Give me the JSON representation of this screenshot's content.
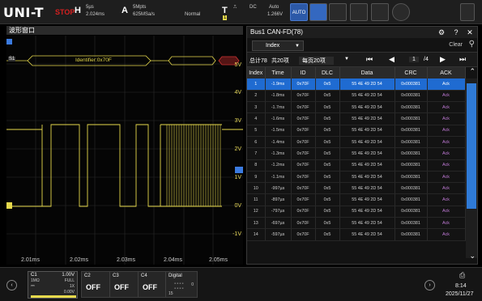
{
  "topbar": {
    "logo": "UNI-T",
    "status": "STOP",
    "horizontal": {
      "letter": "H",
      "timebase": "5µs",
      "offset": "2.024ms"
    },
    "acquire": {
      "letter": "A",
      "depth": "5Mpts",
      "rate": "625MSa/s",
      "mode": "Normal"
    },
    "trigger": {
      "letter": "T",
      "source": "1",
      "coupling": "DC",
      "mode": "Auto",
      "level": "1.266V"
    },
    "auto_label": "AUTO"
  },
  "wave": {
    "title": "波形窗口",
    "decode_label": "Identifier:0x70F",
    "volt_labels": [
      "5V",
      "4V",
      "3V",
      "2V",
      "1V",
      "0V",
      "-1V"
    ],
    "time_labels": [
      "2.01ms",
      "2.02ms",
      "2.03ms",
      "2.04ms",
      "2.05ms"
    ],
    "s1_label": "S1"
  },
  "bus": {
    "title": "Bus1 CAN-FD(78)",
    "select_value": "Index",
    "clear_label": "Clear",
    "total": "总计78",
    "pages_total": "共20项",
    "per_page": "每页20项",
    "page": "1",
    "pages": "/4",
    "columns": [
      "Index",
      "Time",
      "ID",
      "DLC",
      "Data",
      "CRC",
      "ACK"
    ],
    "rows": [
      [
        "1",
        "-1.9ms",
        "0x70F",
        "0x5",
        "55 4E 49 2D 54",
        "0x000381",
        "Ack"
      ],
      [
        "2",
        "-1.8ms",
        "0x70F",
        "0x5",
        "55 4E 49 2D 54",
        "0x000381",
        "Ack"
      ],
      [
        "3",
        "-1.7ms",
        "0x70F",
        "0x5",
        "55 4E 49 2D 54",
        "0x000381",
        "Ack"
      ],
      [
        "4",
        "-1.6ms",
        "0x70F",
        "0x5",
        "55 4E 49 2D 54",
        "0x000381",
        "Ack"
      ],
      [
        "5",
        "-1.5ms",
        "0x70F",
        "0x5",
        "55 4E 49 2D 54",
        "0x000381",
        "Ack"
      ],
      [
        "6",
        "-1.4ms",
        "0x70F",
        "0x5",
        "55 4E 49 2D 54",
        "0x000381",
        "Ack"
      ],
      [
        "7",
        "-1.3ms",
        "0x70F",
        "0x5",
        "55 4E 49 2D 54",
        "0x000381",
        "Ack"
      ],
      [
        "8",
        "-1.2ms",
        "0x70F",
        "0x5",
        "55 4E 49 2D 54",
        "0x000381",
        "Ack"
      ],
      [
        "9",
        "-1.1ms",
        "0x70F",
        "0x5",
        "55 4E 49 2D 54",
        "0x000381",
        "Ack"
      ],
      [
        "10",
        "-997µs",
        "0x70F",
        "0x5",
        "55 4E 49 2D 54",
        "0x000381",
        "Ack"
      ],
      [
        "11",
        "-897µs",
        "0x70F",
        "0x5",
        "55 4E 49 2D 54",
        "0x000381",
        "Ack"
      ],
      [
        "12",
        "-797µs",
        "0x70F",
        "0x5",
        "55 4E 49 2D 54",
        "0x000381",
        "Ack"
      ],
      [
        "13",
        "-697µs",
        "0x70F",
        "0x5",
        "55 4E 49 2D 54",
        "0x000381",
        "Ack"
      ],
      [
        "14",
        "-597µs",
        "0x70F",
        "0x5",
        "55 4E 49 2D 54",
        "0x000381",
        "Ack"
      ]
    ]
  },
  "bottom": {
    "c1": {
      "name": "C1",
      "scale": "1.00V",
      "imp": "1MΩ",
      "bw": "FULL",
      "probe": "1X",
      "offset": "0.00V"
    },
    "c2": {
      "name": "C2",
      "state": "OFF"
    },
    "c3": {
      "name": "C3",
      "state": "OFF"
    },
    "c4": {
      "name": "C4",
      "state": "OFF"
    },
    "digital": {
      "name": "Digital",
      "low": "0",
      "high": "15"
    },
    "time": "8:14",
    "date": "2025/11/27"
  },
  "colors": {
    "ch1": "#e6d94c",
    "accent": "#1f6bd1",
    "stop": "#d42020",
    "ack": "#c27bd9"
  }
}
